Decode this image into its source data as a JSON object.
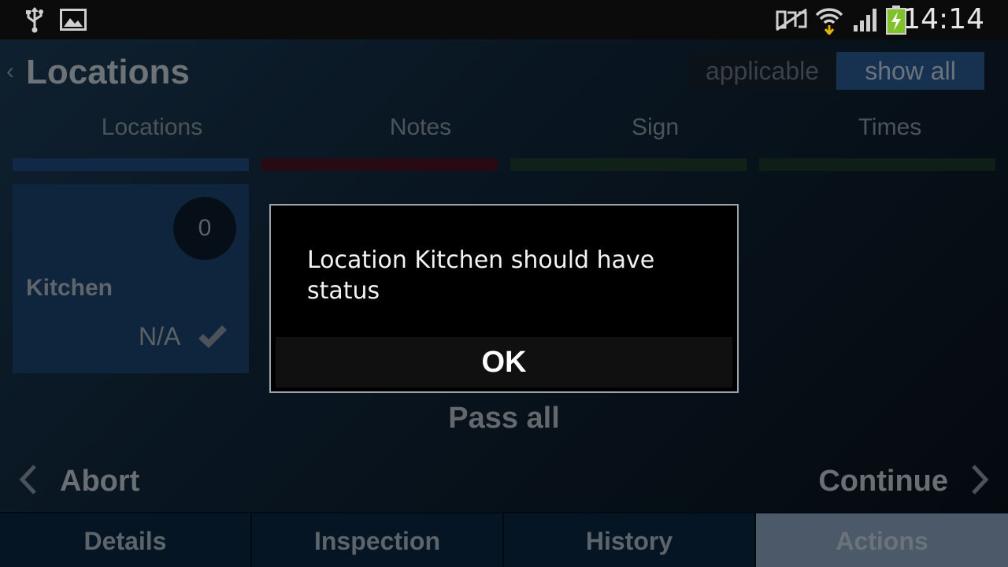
{
  "status_bar": {
    "time": "14:14",
    "left_icons": [
      "usb-icon",
      "image-icon"
    ],
    "right_icons": [
      "nfc-off-icon",
      "wifi-icon",
      "signal-icon",
      "battery-charging-icon"
    ]
  },
  "header": {
    "title": "Locations",
    "filter": {
      "applicable": "applicable",
      "show_all": "show all",
      "selected": "show all"
    }
  },
  "section_tabs": [
    {
      "label": "Locations",
      "color": "#1f4b82"
    },
    {
      "label": "Notes",
      "color": "#4a1422"
    },
    {
      "label": "Sign",
      "color": "#1c3d2e"
    },
    {
      "label": "Times",
      "color": "#1a3a2c"
    }
  ],
  "location_card": {
    "count": "0",
    "name": "Kitchen",
    "status": "N/A"
  },
  "actions": {
    "pass_all": "Pass all",
    "abort": "Abort",
    "continue": "Continue"
  },
  "bottom_tabs": [
    {
      "label": "Details"
    },
    {
      "label": "Inspection"
    },
    {
      "label": "History"
    },
    {
      "label": "Actions",
      "selected": true
    }
  ],
  "dialog": {
    "message": "Location Kitchen should have status",
    "ok": "OK"
  },
  "colors": {
    "accent_blue": "#2a5a92",
    "selected_tab": "#8aa3bd"
  }
}
